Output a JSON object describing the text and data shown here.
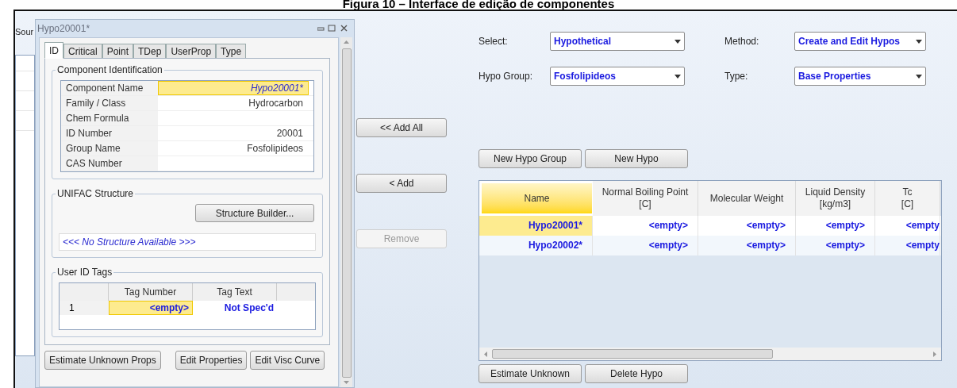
{
  "caption": "Figura 10 – Interface de edição de componentes",
  "source_panel": {
    "label": "Sour"
  },
  "editor": {
    "title": "Hypo20001*",
    "tabs": [
      {
        "label": "ID",
        "selected": true
      },
      {
        "label": "Critical",
        "selected": false
      },
      {
        "label": "Point",
        "selected": false
      },
      {
        "label": "TDep",
        "selected": false
      },
      {
        "label": "UserProp",
        "selected": false
      },
      {
        "label": "Type",
        "selected": false
      }
    ],
    "identification": {
      "title": "Component Identification",
      "rows": [
        {
          "label": "Component Name",
          "value": "Hypo20001*",
          "selected": true
        },
        {
          "label": "Family / Class",
          "value": "Hydrocarbon",
          "selected": false
        },
        {
          "label": "Chem Formula",
          "selected": false
        },
        {
          "label": "ID Number",
          "value": "20001",
          "selected": false
        },
        {
          "label": "Group Name",
          "value": "Fosfolipideos",
          "selected": false
        },
        {
          "label": "CAS Number",
          "selected": false
        }
      ]
    },
    "unifac": {
      "title": "UNIFAC Structure",
      "button": "Structure Builder...",
      "structure": "<<< No Structure Available >>>"
    },
    "tags": {
      "title": "User ID Tags",
      "columns": [
        "Tag Number",
        "Tag Text"
      ],
      "rows": [
        {
          "index": "1",
          "tag_number": "<empty>",
          "tag_text": "Not Spec'd",
          "selected": true
        }
      ]
    },
    "buttons": [
      "Estimate Unknown Props",
      "Edit Properties",
      "Edit Visc Curve"
    ]
  },
  "transfer_buttons": [
    {
      "label": "<< Add All",
      "disabled": false
    },
    {
      "label": "< Add",
      "disabled": false
    },
    {
      "label": "Remove",
      "disabled": true
    }
  ],
  "selectors": [
    {
      "label": "Select:",
      "value": "Hypothetical"
    },
    {
      "label": "Method:",
      "value": "Create and Edit Hypos"
    },
    {
      "label": "Hypo Group:",
      "value": "Fosfolipideos"
    },
    {
      "label": "Type:",
      "value": "Base Properties"
    }
  ],
  "group_buttons": [
    "New Hypo Group",
    "New Hypo"
  ],
  "table": {
    "columns": [
      {
        "label": "Name",
        "selected": true
      },
      {
        "label": "Normal Boiling Point\n[C]",
        "selected": false
      },
      {
        "label": "Molecular Weight",
        "selected": false
      },
      {
        "label": "Liquid Density\n[kg/m3]",
        "selected": false
      },
      {
        "label": "Tc\n[C]",
        "selected": false
      }
    ],
    "rows": [
      {
        "selected": true,
        "cells": [
          "Hypo20001*",
          "<empty>",
          "<empty>",
          "<empty>",
          "<empty"
        ]
      },
      {
        "selected": false,
        "cells": [
          "Hypo20002*",
          "<empty>",
          "<empty>",
          "<empty>",
          "<empty"
        ]
      }
    ]
  },
  "bottom_buttons": [
    "Estimate Unknown",
    "Delete Hypo"
  ]
}
